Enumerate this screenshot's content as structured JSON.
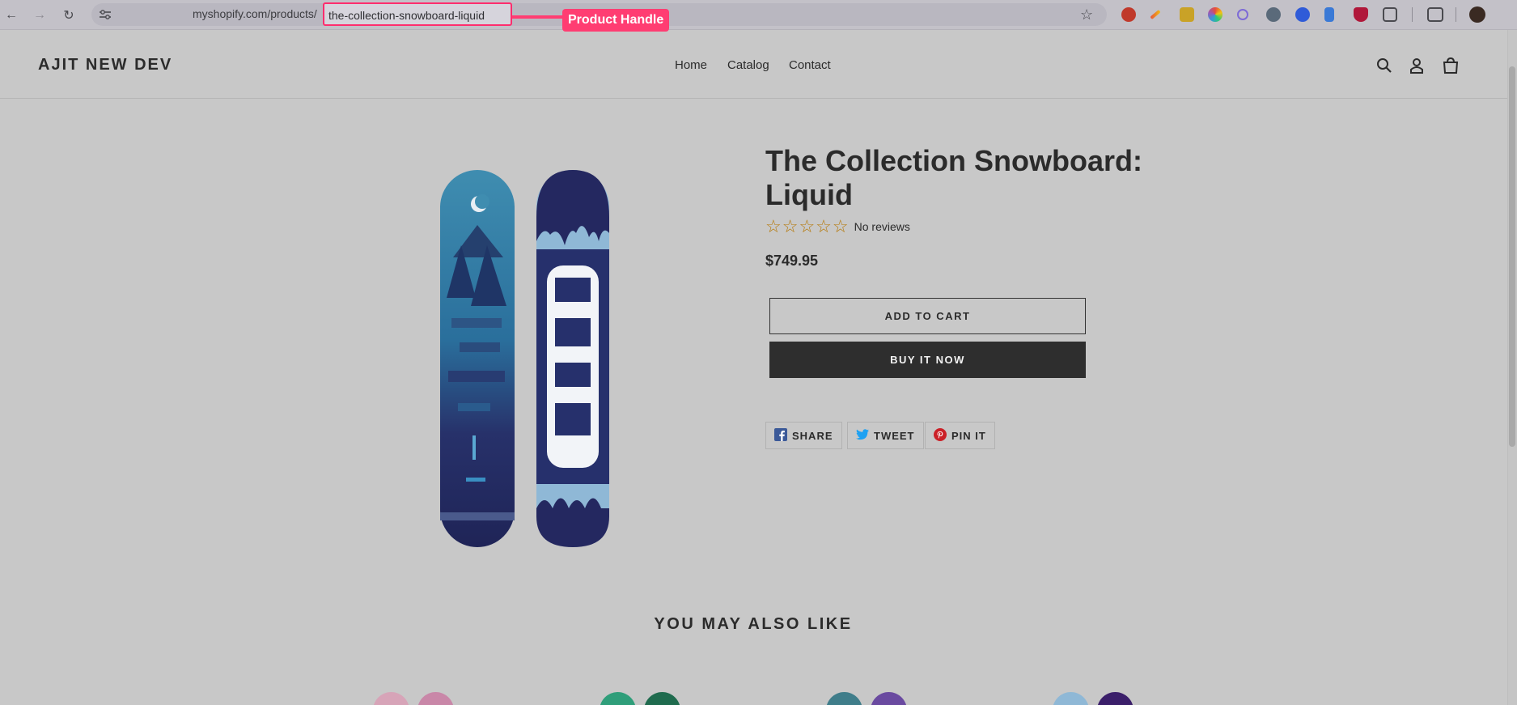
{
  "browser": {
    "url_prefix": "myshopify.com/products/",
    "url_handle": "the-collection-snowboard-liquid",
    "annotation_label": "Product Handle"
  },
  "store": {
    "brand": "AJIT NEW DEV",
    "nav": [
      "Home",
      "Catalog",
      "Contact"
    ]
  },
  "product": {
    "title": "The Collection Snowboard: Liquid",
    "rating_stars": "☆☆☆☆☆",
    "reviews_text": "No reviews",
    "price": "$749.95",
    "add_to_cart": "ADD TO CART",
    "buy_now": "BUY IT NOW",
    "share": [
      "SHARE",
      "TWEET",
      "PIN IT"
    ]
  },
  "related": {
    "heading": "YOU MAY ALSO LIKE"
  },
  "colors": {
    "accent_annotation": "#ff3d72",
    "star": "#b67a0c",
    "buy_button": "#2e2e2e"
  }
}
